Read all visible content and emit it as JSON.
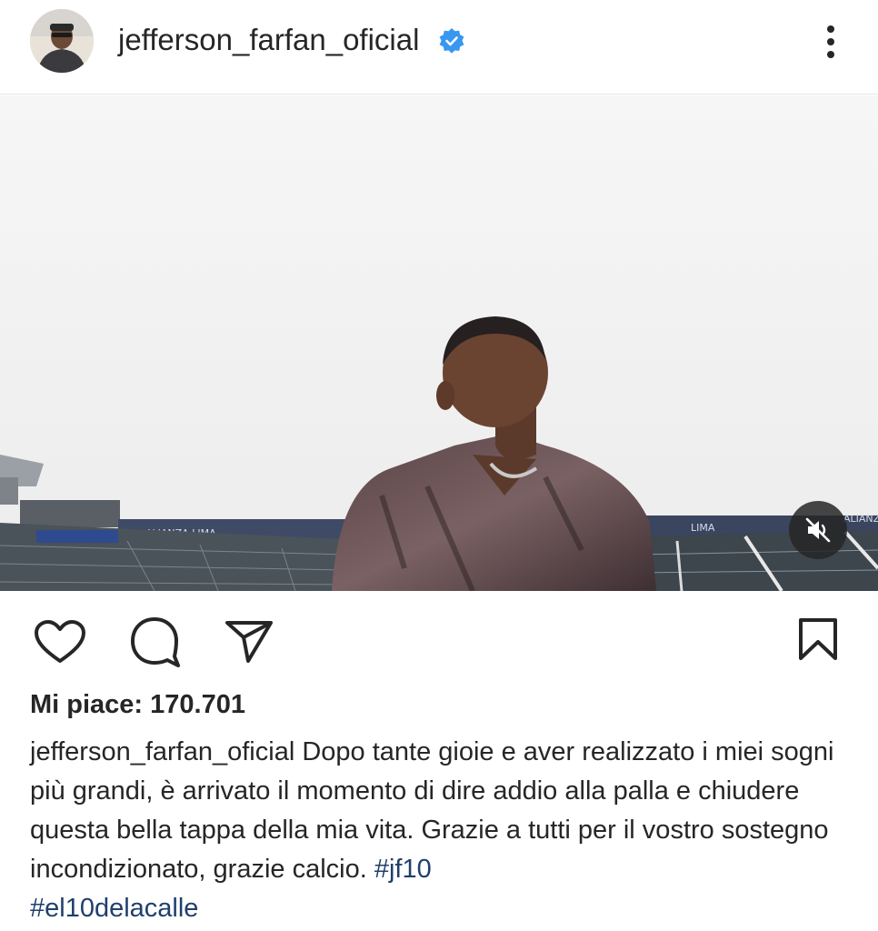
{
  "header": {
    "username": "jefferson_farfan_oficial",
    "verified_icon": "verified-badge-icon",
    "more_icon": "more-vertical-icon"
  },
  "media": {
    "mute_icon": "speaker-muted-icon",
    "stadium_signs": [
      "ALIANZA LIMA",
      "ALIANZA LIMA",
      "LIMA",
      "ALIANZA"
    ]
  },
  "actions": {
    "like_icon": "heart-icon",
    "comment_icon": "comment-icon",
    "share_icon": "share-icon",
    "save_icon": "bookmark-icon"
  },
  "post": {
    "likes_label": "Mi piace: 170.701",
    "caption_user": "jefferson_farfan_oficial",
    "caption_text": " Dopo tante gioie e aver realizzato i miei sogni più grandi, è arrivato il momento di dire addio alla palla e chiudere questa bella tappa della mia vita. Grazie a tutti per il vostro sostegno incondizionato, grazie calcio. ",
    "hashtag_1": "#jf10",
    "hashtag_2": "#el10delacalle"
  },
  "colors": {
    "verified_blue": "#3897f0",
    "hashtag": "#1f3f6e",
    "text": "#262626"
  }
}
